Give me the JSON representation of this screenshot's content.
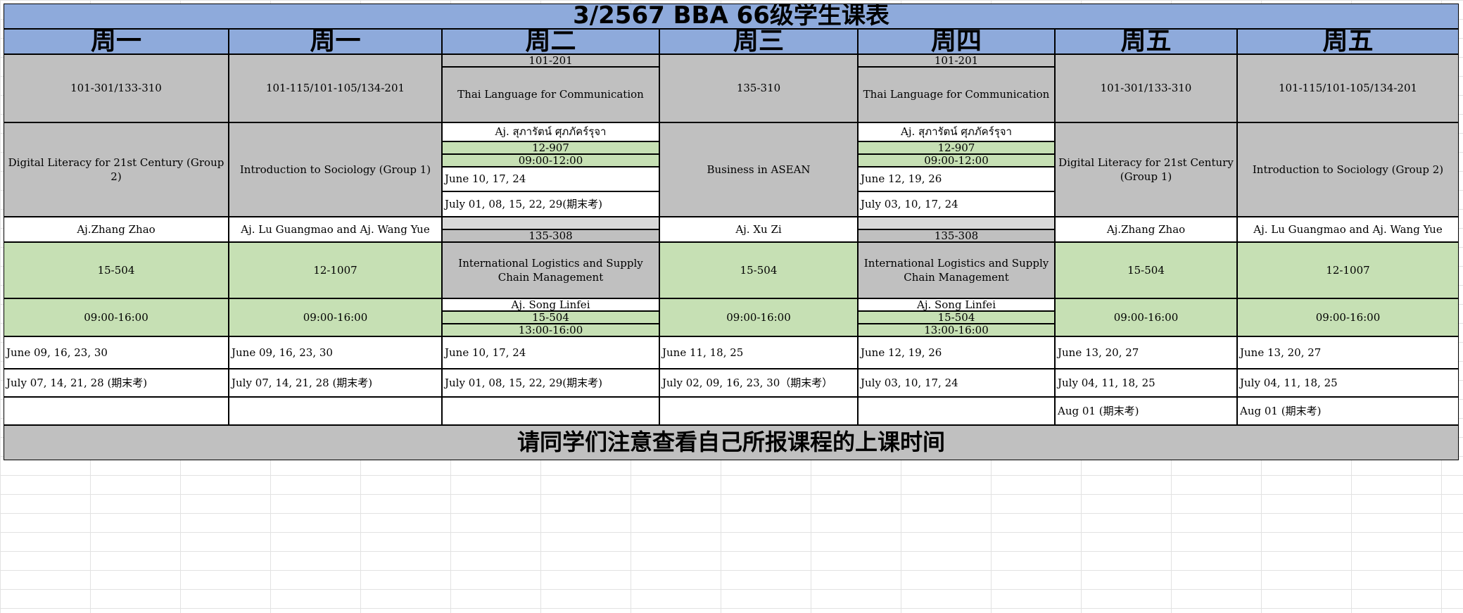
{
  "title": "3/2567  BBA 66级学生课表",
  "days": [
    "周一",
    "周一",
    "周二",
    "周三",
    "周四",
    "周五",
    "周五"
  ],
  "col1": {
    "room": "101-301/133-310",
    "course": "Digital Literacy for 21st Century (Group 2)",
    "teacher": "Aj.Zhang Zhao",
    "room2": "15-504",
    "time": "09:00-16:00",
    "date1": "June 09, 16, 23, 30",
    "date2": "July 07, 14, 21, 28 (期末考)"
  },
  "col2": {
    "room": "101-115/101-105/134-201",
    "course": "Introduction to Sociology (Group 1)",
    "teacher": "Aj. Lu Guangmao and Aj. Wang Yue",
    "room2": "12-1007",
    "time": "09:00-16:00",
    "date1": "June 09, 16, 23, 30",
    "date2": "July 07, 14, 21, 28 (期末考)"
  },
  "col3": {
    "room_top": "101-201",
    "course1": "Thai Language for Communication",
    "teacher1": "Aj. สุภารัตน์ ศุภภัคร์รุจา",
    "room1": "12-907",
    "time1": "09:00-12:00",
    "dates1a": "June 10, 17, 24",
    "dates1b": "July 01, 08, 15, 22, 29(期末考)",
    "room_mid": "135-308",
    "course2": "International Logistics and Supply Chain Management",
    "teacher2": "Aj. Song Linfei",
    "room2": "15-504",
    "time2": "13:00-16:00",
    "date1": "June 10, 17, 24",
    "date2": "July 01, 08, 15, 22, 29(期末考)"
  },
  "col4": {
    "room": "135-310",
    "course": "Business in ASEAN",
    "teacher": "Aj. Xu Zi",
    "room2": "15-504",
    "time": "09:00-16:00",
    "date1": "June 11, 18, 25",
    "date2": "July 02, 09, 16, 23, 30（期末考）"
  },
  "col5": {
    "room_top": "101-201",
    "course1": "Thai Language for Communication",
    "teacher1": "Aj. สุภารัตน์ ศุภภัคร์รุจา",
    "room1": "12-907",
    "time1": "09:00-12:00",
    "dates1a": "June 12, 19, 26",
    "dates1b": "July 03, 10, 17, 24",
    "room_mid": "135-308",
    "course2": "International Logistics and Supply Chain Management",
    "teacher2": "Aj. Song Linfei",
    "room2": "15-504",
    "time2": "13:00-16:00",
    "date1": "June 12, 19, 26",
    "date2": "July 03, 10, 17, 24"
  },
  "col6": {
    "room": "101-301/133-310",
    "course": "Digital Literacy for 21st Century (Group 1)",
    "teacher": "Aj.Zhang Zhao",
    "room2": "15-504",
    "time": "09:00-16:00",
    "date1": "June 13, 20, 27",
    "date2": "July 04, 11, 18, 25",
    "date3": "Aug 01 (期末考)"
  },
  "col7": {
    "room": "101-115/101-105/134-201",
    "course": "Introduction to Sociology (Group 2)",
    "teacher": "Aj. Lu Guangmao and Aj. Wang Yue",
    "room2": "12-1007",
    "time": "09:00-16:00",
    "date1": "June 13, 20, 27",
    "date2": "July 04, 11, 18, 25",
    "date3": "Aug 01 (期末考)"
  },
  "footer": "请同学们注意查看自己所报课程的上课时间",
  "colors": {
    "header_blue": "#8eaadb",
    "gray": "#c0c0c0",
    "light_gray": "#d9d9d9",
    "green": "#c6e0b4"
  }
}
